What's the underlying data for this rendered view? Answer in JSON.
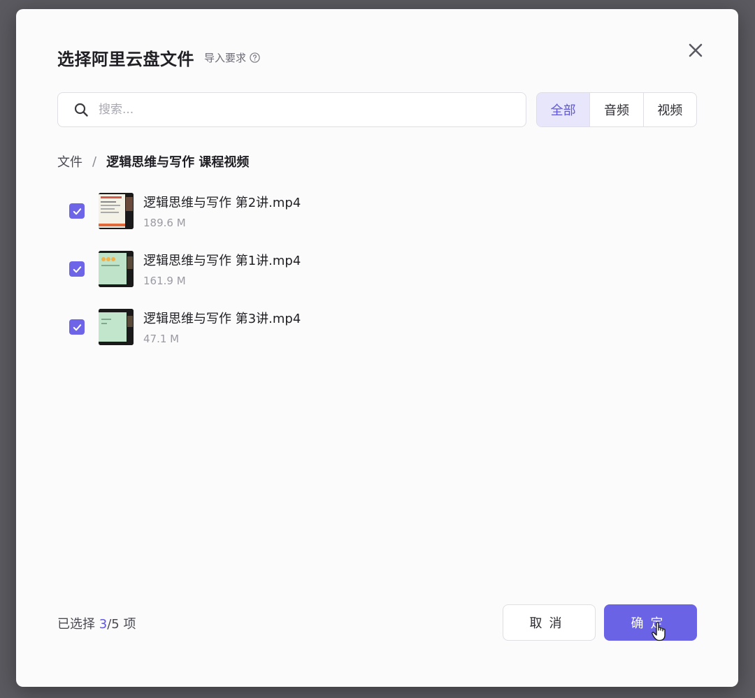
{
  "dialog": {
    "title": "选择阿里云盘文件",
    "import_requirements": "导入要求"
  },
  "search": {
    "placeholder": "搜索..."
  },
  "filters": [
    {
      "label": "全部",
      "active": true
    },
    {
      "label": "音频",
      "active": false
    },
    {
      "label": "视频",
      "active": false
    }
  ],
  "breadcrumb": {
    "root": "文件",
    "separator": "/",
    "current": "逻辑思维与写作 课程视频"
  },
  "files": [
    {
      "name": "逻辑思维与写作 第2讲.mp4",
      "size": "189.6 M",
      "checked": true
    },
    {
      "name": "逻辑思维与写作 第1讲.mp4",
      "size": "161.9 M",
      "checked": true
    },
    {
      "name": "逻辑思维与写作 第3讲.mp4",
      "size": "47.1 M",
      "checked": true
    }
  ],
  "footer": {
    "prefix": "已选择",
    "selected": "3",
    "total": "/5",
    "suffix": "项",
    "cancel_label": "取消",
    "confirm_label": "确定"
  },
  "colors": {
    "accent": "#6b63e6",
    "accent_light": "#e7e6fb"
  }
}
